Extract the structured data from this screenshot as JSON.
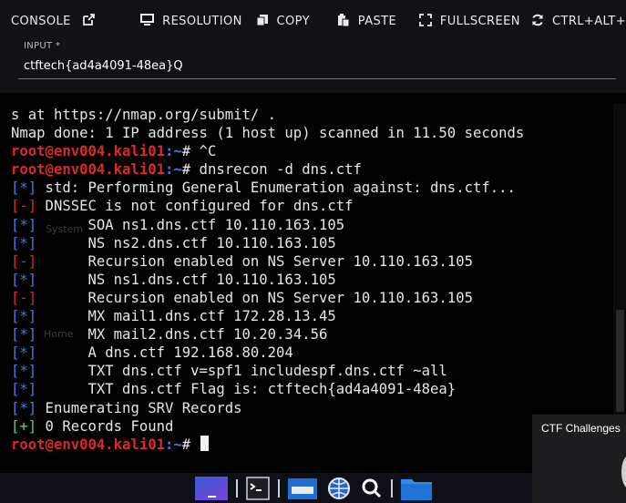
{
  "toolbar": {
    "console_label": "CONSOLE",
    "resolution_label": "RESOLUTION",
    "copy_label": "COPY",
    "paste_label": "PASTE",
    "fullscreen_label": "FULLSCREEN",
    "ctrl_alt_label": "CTRL+ALT+"
  },
  "input": {
    "label": "INPUT *",
    "value": "ctftech{ad4a4091-48ea}Q"
  },
  "terminal": {
    "prompt": {
      "user_host": "root@env004.kali01",
      "path": ":~",
      "symbol": "#"
    },
    "lines": [
      {
        "kind": "plain",
        "text": "s at https://nmap.org/submit/ ."
      },
      {
        "kind": "plain",
        "text": "Nmap done: 1 IP address (1 host up) scanned in 11.50 seconds"
      },
      {
        "kind": "prompt",
        "cmd": " ^C"
      },
      {
        "kind": "prompt",
        "cmd": " dnsrecon -d dns.ctf"
      },
      {
        "kind": "tag",
        "tag": "[*]",
        "color": "blue",
        "text": " std: Performing General Enumeration against: dns.ctf..."
      },
      {
        "kind": "tag",
        "tag": "[-]",
        "color": "red",
        "text": " DNSSEC is not configured for dns.ctf"
      },
      {
        "kind": "tag",
        "tag": "[*]",
        "color": "blue",
        "text": "      SOA ns1.dns.ctf 10.110.163.105"
      },
      {
        "kind": "tag",
        "tag": "[*]",
        "color": "blue",
        "text": "      NS ns2.dns.ctf 10.110.163.105"
      },
      {
        "kind": "tag",
        "tag": "[-]",
        "color": "red",
        "text": "      Recursion enabled on NS Server 10.110.163.105"
      },
      {
        "kind": "tag",
        "tag": "[*]",
        "color": "blue",
        "text": "      NS ns1.dns.ctf 10.110.163.105"
      },
      {
        "kind": "tag",
        "tag": "[-]",
        "color": "red",
        "text": "      Recursion enabled on NS Server 10.110.163.105"
      },
      {
        "kind": "tag",
        "tag": "[*]",
        "color": "blue",
        "text": "      MX mail1.dns.ctf 172.28.13.45"
      },
      {
        "kind": "tag",
        "tag": "[*]",
        "color": "blue",
        "text": "      MX mail2.dns.ctf 10.20.34.56"
      },
      {
        "kind": "tag",
        "tag": "[*]",
        "color": "blue",
        "text": "      A dns.ctf 192.168.80.204"
      },
      {
        "kind": "tag",
        "tag": "[*]",
        "color": "blue",
        "text": "      TXT dns.ctf v=spf1 includespf.dns.ctf ~all"
      },
      {
        "kind": "tag",
        "tag": "[*]",
        "color": "blue",
        "text": "      TXT dns.ctf Flag is: ctftech{ad4a4091-48ea}"
      },
      {
        "kind": "tag",
        "tag": "[*]",
        "color": "blue",
        "text": " Enumerating SRV Records"
      },
      {
        "kind": "tag",
        "tag": "[+]",
        "color": "green",
        "text": " 0 Records Found"
      },
      {
        "kind": "prompt",
        "cmd": " ",
        "cursor": true
      }
    ]
  },
  "popup": {
    "title": "CTF Challenges"
  },
  "colors": {
    "prompt_red": "#d92a2a",
    "prompt_blue": "#3f7ee0",
    "tag_green": "#4fd27a",
    "toolbar_bg": "#111215",
    "taskbar_bg": "#0d1117"
  },
  "taskbar": {
    "icons": [
      "kali-menu-icon",
      "terminal-icon",
      "file-manager-icon",
      "browser-globe-icon",
      "search-icon",
      "folder-icon"
    ]
  }
}
